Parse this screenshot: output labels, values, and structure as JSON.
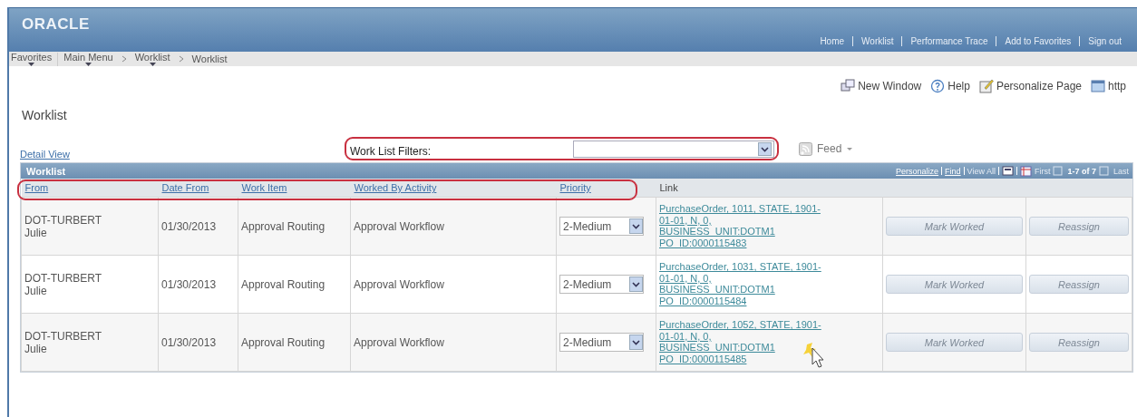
{
  "header": {
    "logo": "ORACLE",
    "links": [
      "Home",
      "Worklist",
      "Performance Trace",
      "Add to Favorites",
      "Sign out"
    ]
  },
  "breadcrumbs": [
    {
      "label": "Favorites",
      "menu": true
    },
    {
      "label": "Main Menu",
      "menu": true
    },
    {
      "label": "Worklist",
      "menu": true
    },
    {
      "label": "Worklist",
      "menu": false
    }
  ],
  "page_tools": [
    {
      "kind": "window",
      "label": "New Window"
    },
    {
      "kind": "help",
      "label": "Help"
    },
    {
      "kind": "personalize",
      "label": "Personalize Page"
    },
    {
      "kind": "link",
      "label": "http"
    }
  ],
  "page_title": "Worklist",
  "detail_view": "Detail View",
  "filters": {
    "label": "Work List Filters:",
    "highlighted": true
  },
  "feed": "Feed",
  "grid": {
    "title": "Worklist",
    "nav": [
      {
        "kind": "text",
        "label": "Personalize",
        "disabled": false
      },
      {
        "kind": "text",
        "label": "Find",
        "disabled": false
      },
      {
        "kind": "text",
        "label": "View All",
        "disabled": true
      },
      {
        "kind": "zoom"
      },
      {
        "kind": "download"
      },
      {
        "kind": "text",
        "label": "First",
        "disabled": true
      },
      {
        "kind": "prev"
      },
      {
        "kind": "count",
        "label": "1-7 of 7"
      },
      {
        "kind": "next"
      },
      {
        "kind": "text",
        "label": "Last",
        "disabled": true
      }
    ],
    "columns_highlighted": true,
    "columns": [
      {
        "label": "From",
        "sortable": true
      },
      {
        "label": "Date From",
        "sortable": true
      },
      {
        "label": "Work Item",
        "sortable": true
      },
      {
        "label": "Worked By Activity",
        "sortable": true
      },
      {
        "label": "Priority",
        "sortable": true
      },
      {
        "label": "Link",
        "sortable": false
      }
    ],
    "rows": [
      {
        "from": "DOT-TURBERT",
        "from_name": "Julie",
        "date": "01/30/2013",
        "work_item": "Approval Routing",
        "activity": "Approval Workflow",
        "priority": "2-Medium",
        "link": [
          "PurchaseOrder, 1011, STATE, 1901-",
          "01-01, N, 0,",
          "BUSINESS_UNIT:DOTM1",
          "PO_ID:0000115483"
        ],
        "mark": {
          "label": "Mark Worked",
          "disabled": true
        },
        "reassign": {
          "label": "Reassign",
          "disabled": true
        },
        "cursor": false
      },
      {
        "from": "DOT-TURBERT",
        "from_name": "Julie",
        "date": "01/30/2013",
        "work_item": "Approval Routing",
        "activity": "Approval Workflow",
        "priority": "2-Medium",
        "link": [
          "PurchaseOrder, 1031, STATE, 1901-",
          "01-01, N, 0,",
          "BUSINESS_UNIT:DOTM1",
          "PO_ID:0000115484"
        ],
        "mark": {
          "label": "Mark Worked",
          "disabled": true
        },
        "reassign": {
          "label": "Reassign",
          "disabled": true
        },
        "cursor": false
      },
      {
        "from": "DOT-TURBERT",
        "from_name": "Julie",
        "date": "01/30/2013",
        "work_item": "Approval Routing",
        "activity": "Approval Workflow",
        "priority": "2-Medium",
        "link": [
          "PurchaseOrder, 1052, STATE, 1901-",
          "01-01, N, 0,",
          "BUSINESS_UNIT:DOTM1",
          "PO_ID:0000115485"
        ],
        "mark": {
          "label": "Mark Worked",
          "disabled": true
        },
        "reassign": {
          "label": "Reassign",
          "disabled": true
        },
        "cursor": true
      }
    ]
  }
}
